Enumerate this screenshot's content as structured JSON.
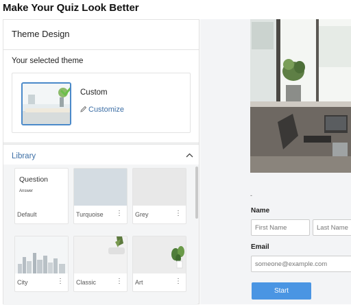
{
  "page": {
    "title": "Make Your Quiz Look Better"
  },
  "panel": {
    "header": "Theme Design",
    "selected_label": "Your selected theme",
    "selected_theme": {
      "name": "Custom",
      "customize_label": "Customize"
    },
    "library_label": "Library",
    "themes": [
      {
        "name": "Default",
        "preview_title": "Question",
        "preview_answer": "Answer"
      },
      {
        "name": "Turquoise",
        "color": "#d4dce2"
      },
      {
        "name": "Grey",
        "color": "#e8e8e8"
      },
      {
        "name": "City"
      },
      {
        "name": "Classic",
        "color": "#f2f2f2"
      },
      {
        "name": "Art",
        "color": "#ececec"
      }
    ]
  },
  "preview": {
    "dash": "-",
    "name_label": "Name",
    "first_name_placeholder": "First Name",
    "last_name_placeholder": "Last Name",
    "email_label": "Email",
    "email_placeholder": "someone@example.com",
    "start_label": "Start"
  },
  "colors": {
    "accent": "#4a95e3",
    "link": "#3c6ea5",
    "selected_border": "#4a89c9"
  }
}
